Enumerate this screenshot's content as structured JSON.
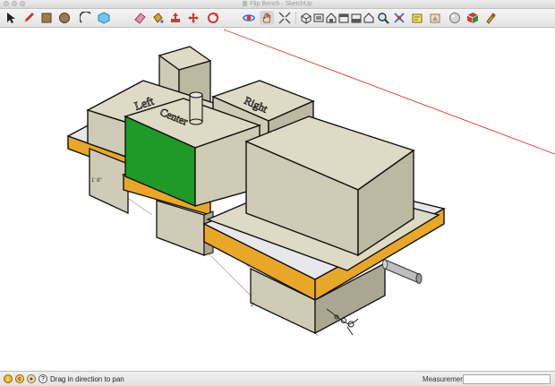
{
  "window": {
    "title": "Flip Bench - SketchUp"
  },
  "toolbar": {
    "tools": [
      {
        "name": "select-tool",
        "icon": "arrow-cursor-icon"
      },
      {
        "name": "pencil-tool",
        "icon": "pencil-icon"
      },
      {
        "name": "rectangle-tool",
        "icon": "rectangle-icon"
      },
      {
        "name": "circle-tool",
        "icon": "circle-icon"
      },
      {
        "name": "arc-tool",
        "icon": "arc-icon"
      },
      {
        "name": "make-component-tool",
        "icon": "component-icon"
      },
      {
        "name": "eraser-tool",
        "icon": "eraser-icon"
      },
      {
        "name": "paint-bucket-tool",
        "icon": "paint-bucket-icon"
      },
      {
        "name": "push-pull-tool",
        "icon": "push-pull-icon"
      },
      {
        "name": "move-tool",
        "icon": "move-icon"
      },
      {
        "name": "rotate-tool",
        "icon": "rotate-icon"
      },
      {
        "name": "orbit-tool",
        "icon": "orbit-icon"
      },
      {
        "name": "pan-tool",
        "icon": "pan-hand-icon"
      },
      {
        "name": "zoom-extents-tool",
        "icon": "zoom-extents-icon"
      },
      {
        "name": "iso-view",
        "icon": "iso-view-icon"
      },
      {
        "name": "top-view",
        "icon": "top-view-icon"
      },
      {
        "name": "front-view",
        "icon": "front-view-icon"
      },
      {
        "name": "right-view",
        "icon": "right-view-icon"
      },
      {
        "name": "back-view",
        "icon": "back-view-icon"
      },
      {
        "name": "left-view",
        "icon": "left-view-icon"
      },
      {
        "name": "zoom-tool",
        "icon": "magnifier-icon"
      },
      {
        "name": "zoom-window-tool",
        "icon": "zoom-window-icon"
      },
      {
        "name": "get-models",
        "icon": "3d-warehouse-icon"
      },
      {
        "name": "share-model",
        "icon": "share-model-icon"
      },
      {
        "name": "styles",
        "icon": "styles-icon"
      },
      {
        "name": "components",
        "icon": "components-icon"
      },
      {
        "name": "extension-warehouse",
        "icon": "extension-icon"
      }
    ]
  },
  "model": {
    "label_left": "Left",
    "label_right": "Right",
    "label_center": "Center",
    "dimension_left": "1' 8\"",
    "dimension_bottom": "2'"
  },
  "status": {
    "message": "Drag in direction to pan",
    "measurements_label": "Measurements",
    "measurements_value": ""
  },
  "colors": {
    "wood": "#cfcbb6",
    "wood_dark": "#aaa690",
    "green_face": "#1f9a28",
    "orange_band": "#e9a72a",
    "axis_red": "#cc2222"
  }
}
